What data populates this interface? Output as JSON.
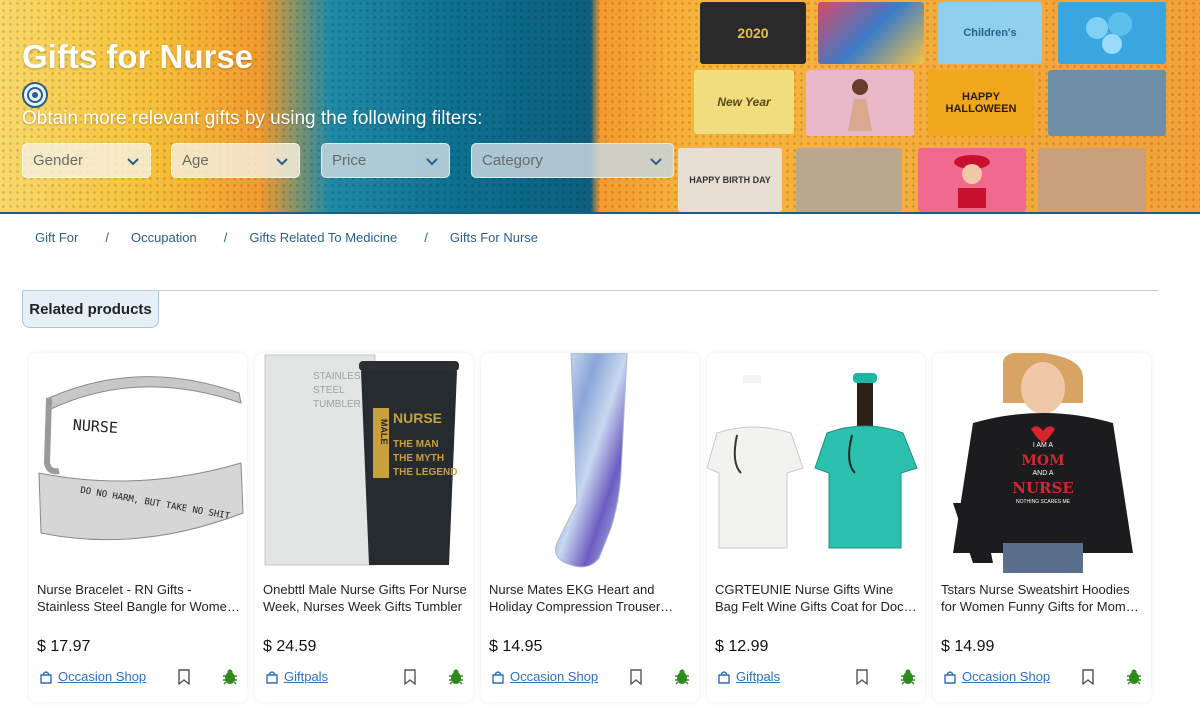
{
  "banner": {
    "title": "Gifts for Nurse",
    "subtitle": "Obtain more relevant gifts by using the following filters:",
    "filters": [
      {
        "label": "Gender"
      },
      {
        "label": "Age"
      },
      {
        "label": "Price"
      },
      {
        "label": "Category"
      }
    ],
    "collage_text": {
      "new_year": "New Year",
      "happy": "HAPPY",
      "halloween": "HALLOWEEN",
      "birthday": "HAPPY BIRTH DAY",
      "childrens": "Children's",
      "year2020": "2020"
    }
  },
  "breadcrumb": [
    "Gift For",
    "Occupation",
    "Gifts Related To Medicine",
    "Gifts For Nurse"
  ],
  "breadcrumb_separator": "/",
  "related": {
    "heading": "Related products",
    "products": [
      {
        "title": "Nurse Bracelet - RN Gifts - Stainless Steel Bangle for Women Nurse Gifts",
        "price": "$ 17.97",
        "shop": "Occasion Shop",
        "image_text": [
          "NURSE",
          "DO NO HARM, BUT TAKE NO SHIT"
        ]
      },
      {
        "title": "Onebttl Male Nurse Gifts For Nurse Week, Nurses Week Gifts Tumbler",
        "price": "$ 24.59",
        "shop": "Giftpals",
        "image_text": [
          "STAINLESS",
          "STEEL",
          "TUMBLER",
          "MALE",
          "NURSE",
          "THE MAN",
          "THE MYTH",
          "THE LEGEND"
        ]
      },
      {
        "title": "Nurse Mates EKG Heart and Holiday Compression Trouser Socks",
        "price": "$ 14.95",
        "shop": "Occasion Shop",
        "image_text": []
      },
      {
        "title": "CGRTEUNIE Nurse Gifts Wine Bag Felt Wine Gifts Coat for Doctor Nurse",
        "price": "$ 12.99",
        "shop": "Giftpals",
        "image_text": []
      },
      {
        "title": "Tstars Nurse Sweatshirt Hoodies for Women Funny Gifts for Mom Nurse",
        "price": "$ 14.99",
        "shop": "Occasion Shop",
        "image_text": [
          "I AM A",
          "MOM",
          "AND A",
          "NURSE",
          "NOTHING SCARES ME"
        ]
      }
    ]
  },
  "colors": {
    "brand_blue": "#2b5f89",
    "link_blue": "#2c6fc0",
    "bug_green": "#2f8a1e"
  }
}
